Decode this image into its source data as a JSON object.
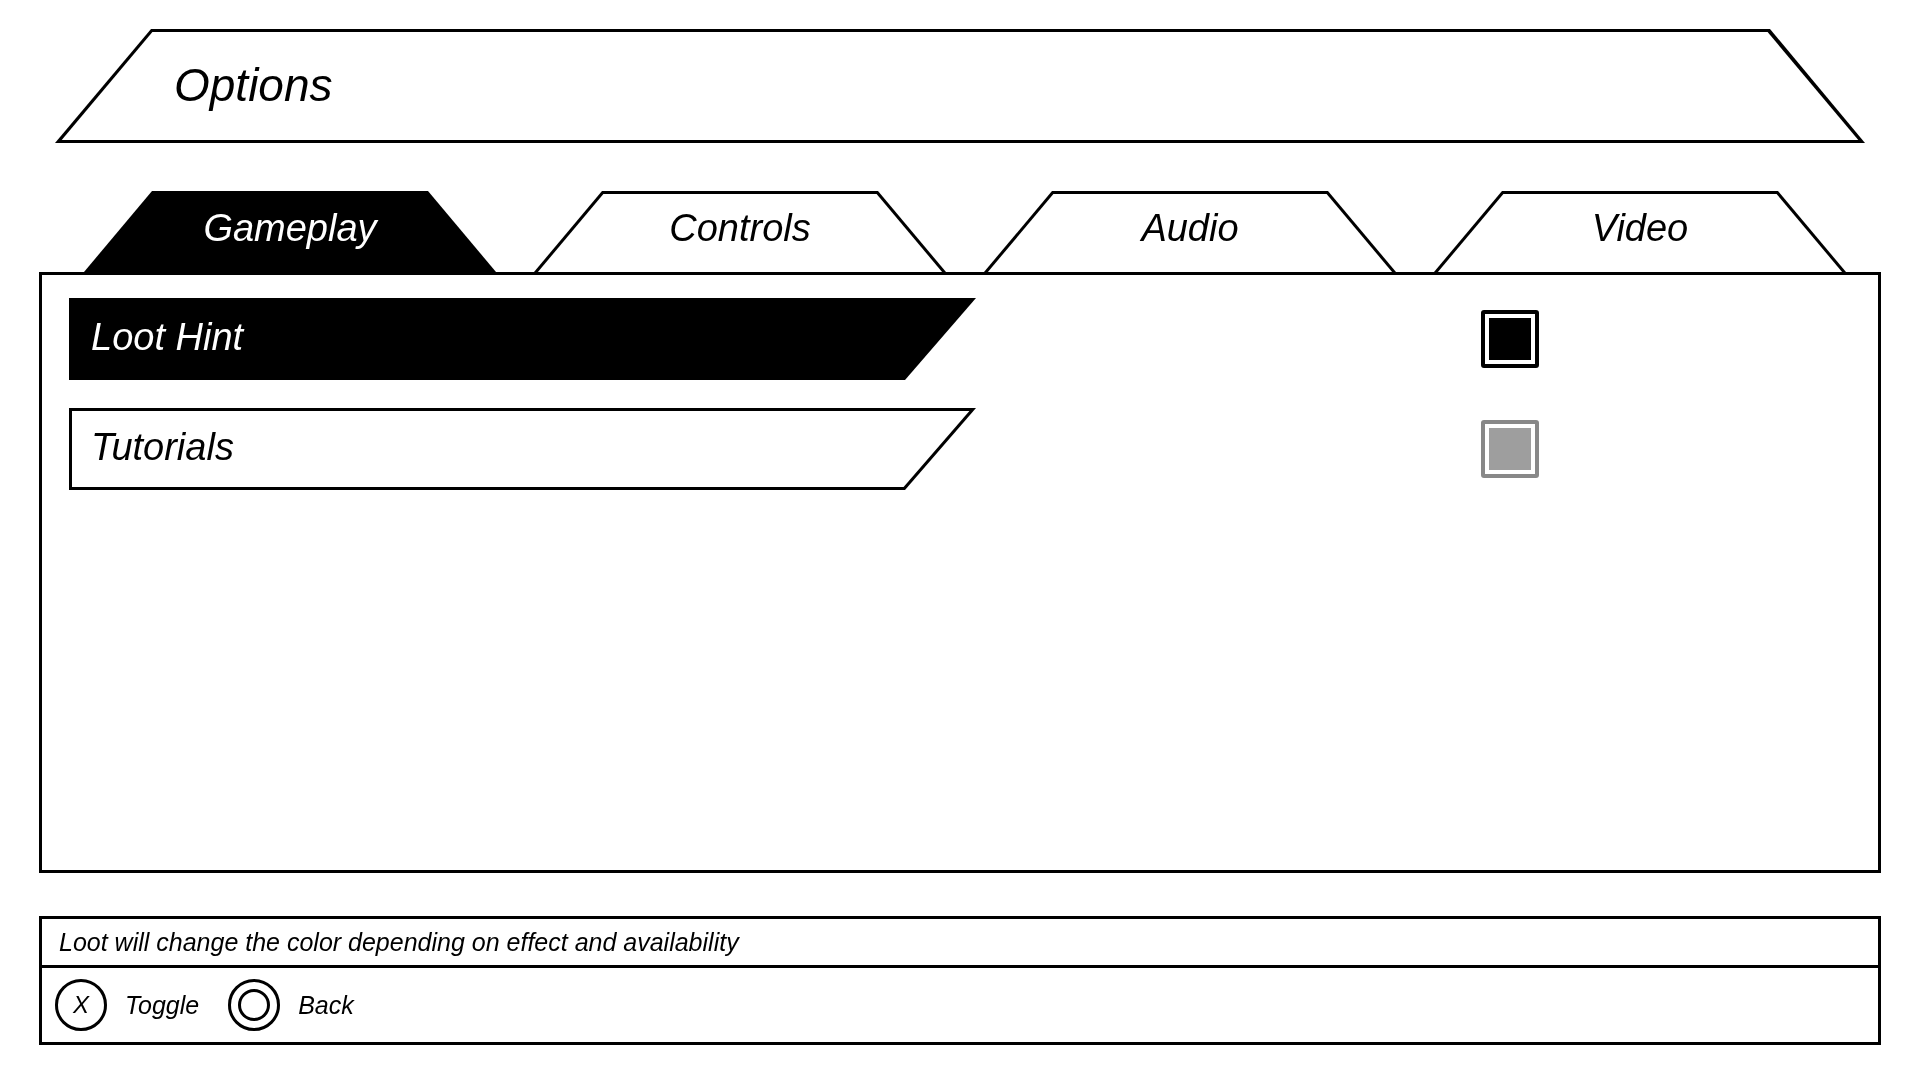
{
  "header": {
    "title": "Options"
  },
  "tabs": [
    {
      "label": "Gameplay",
      "selected": true
    },
    {
      "label": "Controls",
      "selected": false
    },
    {
      "label": "Audio",
      "selected": false
    },
    {
      "label": "Video",
      "selected": false
    }
  ],
  "settings": [
    {
      "label": "Loot Hint",
      "selected": true,
      "checked": true
    },
    {
      "label": "Tutorials",
      "selected": false,
      "checked": true
    }
  ],
  "description": "Loot will change the color depending on effect and availability",
  "button_hints": [
    {
      "kind": "letter",
      "key": "X",
      "label": "Toggle"
    },
    {
      "kind": "ring",
      "label": "Back"
    }
  ]
}
